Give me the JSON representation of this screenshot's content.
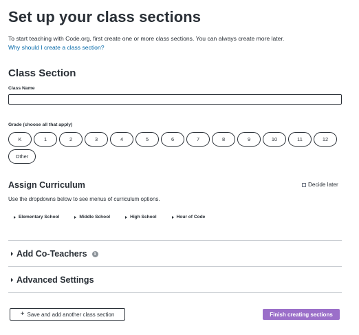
{
  "page": {
    "title": "Set up your class sections",
    "intro": "To start teaching with Code.org, first create one or more class sections. You can always create more later.",
    "why_link": "Why should I create a class section?"
  },
  "class_section": {
    "heading": "Class Section",
    "class_name_label": "Class Name",
    "class_name_value": "",
    "grade_label": "Grade (choose all that apply)",
    "grades": [
      "K",
      "1",
      "2",
      "3",
      "4",
      "5",
      "6",
      "7",
      "8",
      "9",
      "10",
      "11",
      "12",
      "Other"
    ]
  },
  "curriculum": {
    "title": "Assign Curriculum",
    "decide_later_label": "Decide later",
    "decide_later_checked": false,
    "help_text": "Use the dropdowns below to see menus of curriculum options.",
    "options": [
      "Elementary School",
      "Middle School",
      "High School",
      "Hour of Code"
    ]
  },
  "collapsibles": {
    "co_teachers": "Add Co-Teachers",
    "advanced": "Advanced Settings"
  },
  "actions": {
    "save_add_label": "Save and add another class section",
    "finish_label": "Finish creating sections"
  },
  "colors": {
    "text": "#292f36",
    "link": "#0067a8",
    "finish_button": "#9b6fc9",
    "divider": "#c8ccd1"
  },
  "icons": {
    "info": "info-icon",
    "expand": "caret-right-icon",
    "plus": "plus-icon"
  }
}
